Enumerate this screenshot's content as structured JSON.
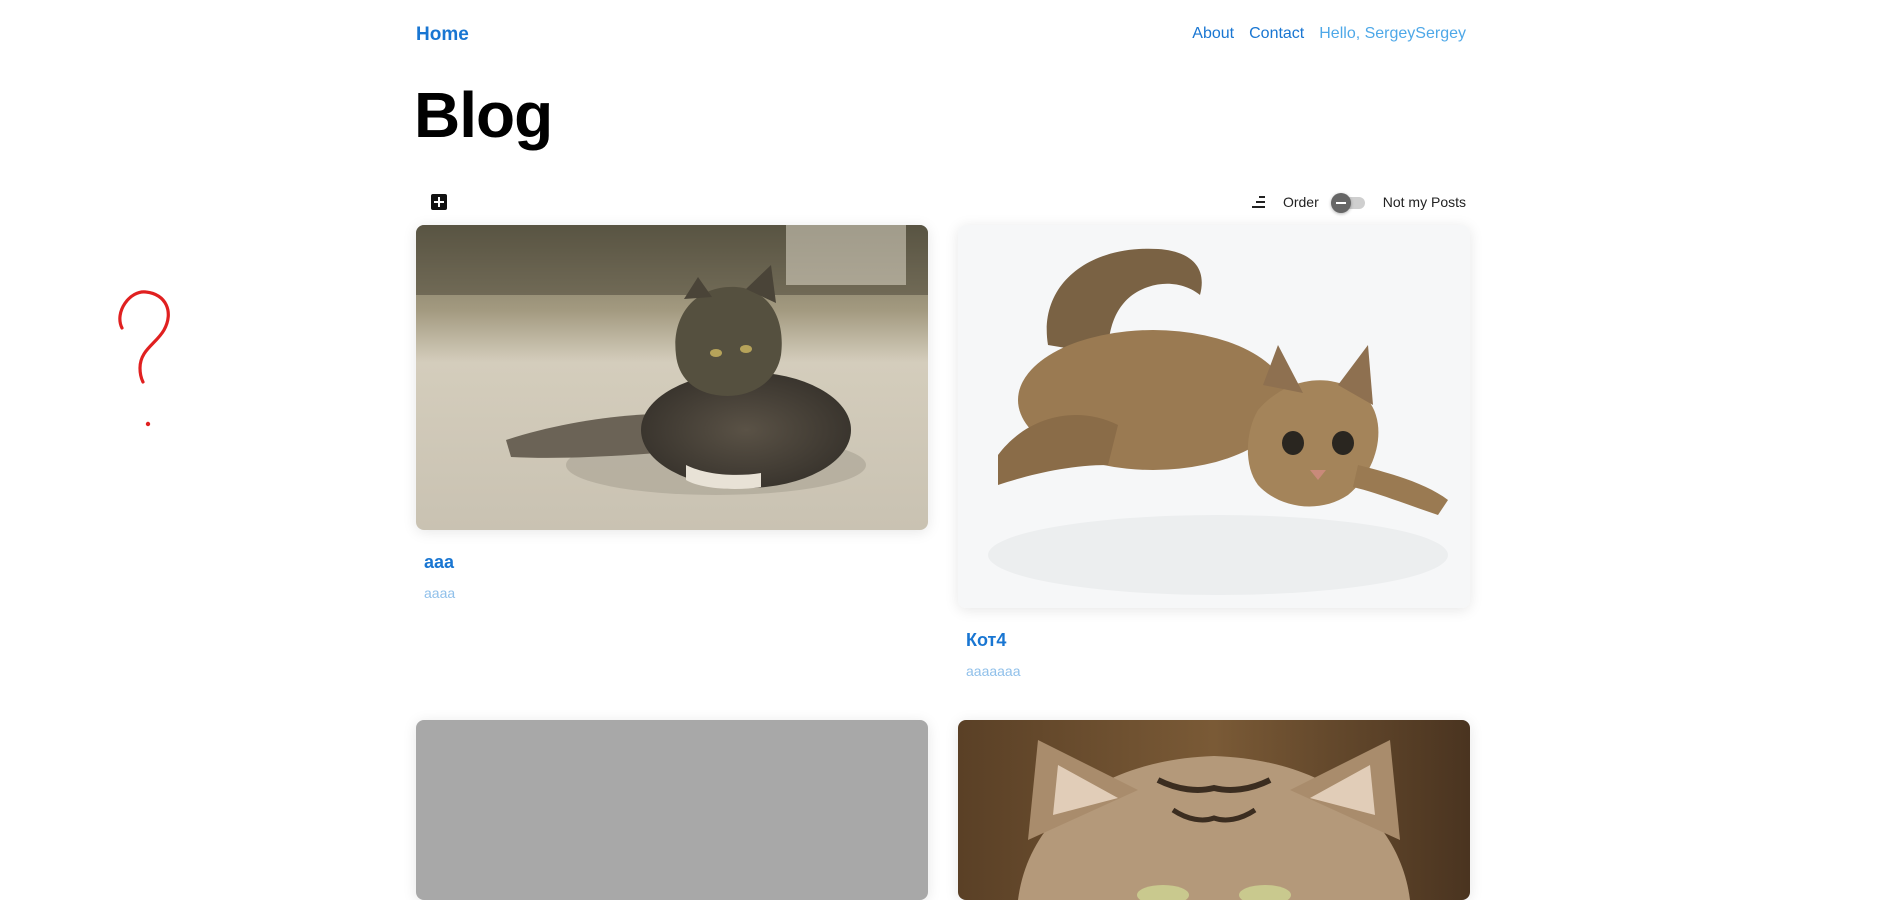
{
  "header": {
    "home": "Home",
    "links": [
      "About",
      "Contact"
    ],
    "user_greeting": "Hello, SergeySergey"
  },
  "page": {
    "title": "Blog"
  },
  "toolbar": {
    "add_icon": "plus-square-icon",
    "sort_icon": "sort-lines-icon",
    "order_label": "Order",
    "not_my_posts_label": "Not my Posts",
    "not_my_posts_toggle_on": false
  },
  "posts": [
    {
      "title": "aaa",
      "subtitle": "aaaa",
      "image": "cat-lying-on-floor"
    },
    {
      "title": "Кот4",
      "subtitle": "aaaaaaa",
      "image": "kitten-crouching-white-background"
    },
    {
      "title": "",
      "subtitle": "",
      "image": "placeholder-gray"
    },
    {
      "title": "",
      "subtitle": "",
      "image": "cat-face-closeup"
    }
  ],
  "colors": {
    "link": "#1976d2",
    "user_link": "#4ea8e8",
    "subtitle": "#90c0ea",
    "placeholder": "#a8a8a8",
    "doodle": "#e02020"
  }
}
